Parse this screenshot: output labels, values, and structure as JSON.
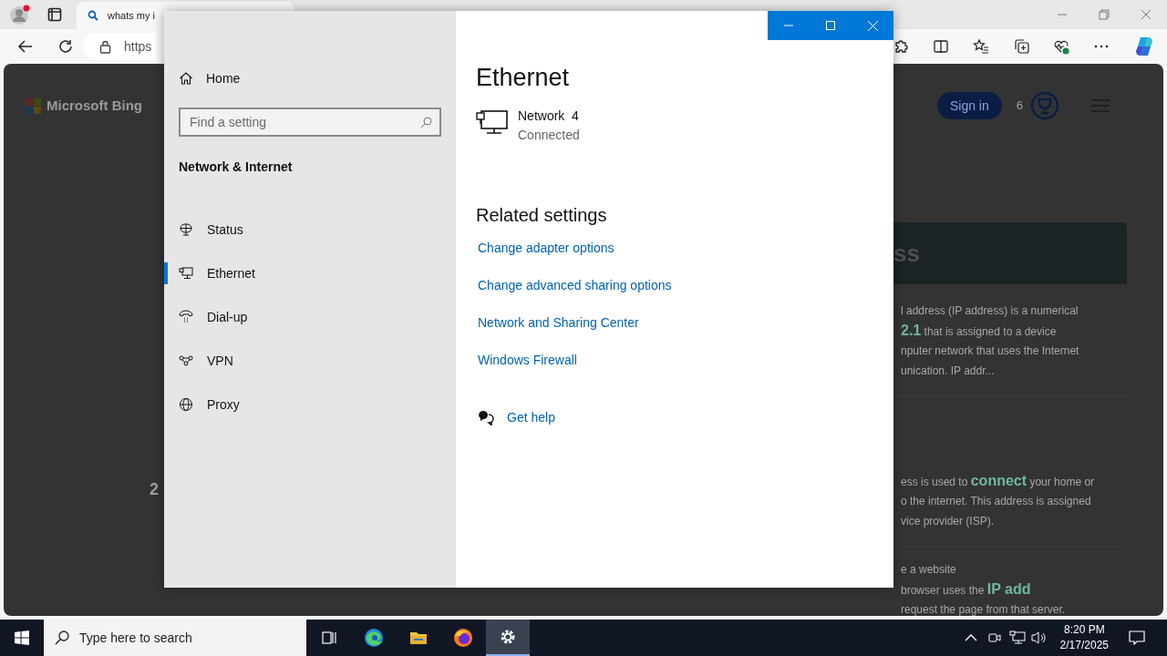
{
  "browser": {
    "tab_title": "whats my i",
    "address": "https",
    "page": {
      "logo": "Microsoft Bing",
      "sign_in": "Sign in",
      "rewards_count": "6",
      "heading_fragment": "ss",
      "number_fragment": "2",
      "paragraphs": [
        [
          "l address (IP address) is a numerical",
          "**2.1** that is assigned to a device",
          "nputer network that uses the Internet",
          "unication. IP addr..."
        ],
        [
          "ess is used to **connect** your home or",
          "o the internet. This address is assigned",
          "vice provider (ISP)."
        ],
        [
          "e a website",
          "browser uses the **IP add**",
          "request the page from that server."
        ]
      ]
    }
  },
  "settings": {
    "home": "Home",
    "search": {
      "placeholder": "Find a setting"
    },
    "section": "Network & Internet",
    "nav": [
      {
        "label": "Status",
        "kind": "status",
        "selected": false
      },
      {
        "label": "Ethernet",
        "kind": "ethernet",
        "selected": true
      },
      {
        "label": "Dial-up",
        "kind": "dialup",
        "selected": false
      },
      {
        "label": "VPN",
        "kind": "vpn",
        "selected": false
      },
      {
        "label": "Proxy",
        "kind": "proxy",
        "selected": false
      }
    ],
    "title": "Ethernet",
    "network": {
      "name": "Network  4",
      "status": "Connected"
    },
    "related_title": "Related settings",
    "related_links": [
      "Change adapter options",
      "Change advanced sharing options",
      "Network and Sharing Center",
      "Windows Firewall"
    ],
    "help": "Get help"
  },
  "taskbar": {
    "search_placeholder": "Type here to search",
    "apps": [
      {
        "kind": "taskview",
        "selected": false
      },
      {
        "kind": "edge",
        "selected": false
      },
      {
        "kind": "explorer",
        "selected": false
      },
      {
        "kind": "firefox",
        "selected": false
      },
      {
        "kind": "settings",
        "selected": true
      }
    ],
    "time": "8:20 PM",
    "date": "2/17/2025"
  }
}
